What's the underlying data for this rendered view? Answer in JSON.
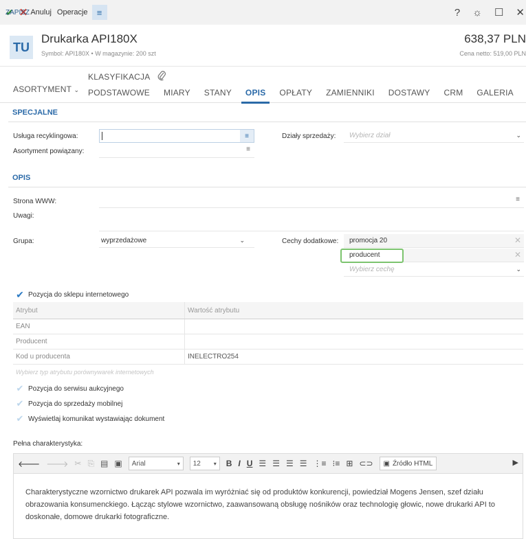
{
  "toolbar": {
    "save_label": "ZAPISZ",
    "cancel_label": "Anuluj",
    "operations_label": "Operacje",
    "menu_icon": "≡",
    "help_icon": "?",
    "settings_icon": "☼",
    "maximize_icon": "☐",
    "close_icon": "✕"
  },
  "header": {
    "badge": "TU",
    "name": "Drukarka API180X",
    "subtitle": "Symbol: API180X  •  W magazynie: 200 szt",
    "price": "638,37 PLN",
    "net_price": "Cena netto: 519,00 PLN"
  },
  "tabs": {
    "asortyment": "ASORTYMENT",
    "klasyfikacja": "KLASYFIKACJA",
    "row": [
      {
        "label": "PODSTAWOWE",
        "active": false
      },
      {
        "label": "MIARY",
        "active": false
      },
      {
        "label": "STANY",
        "active": false
      },
      {
        "label": "OPIS",
        "active": true
      },
      {
        "label": "OPŁATY",
        "active": false
      },
      {
        "label": "ZAMIENNIKI",
        "active": false
      },
      {
        "label": "DOSTAWY",
        "active": false
      },
      {
        "label": "CRM",
        "active": false
      },
      {
        "label": "GALERIA",
        "active": false
      }
    ]
  },
  "specjalne": {
    "title": "SPECJALNE",
    "recycling_label": "Usługa recyklingowa:",
    "recycling_value": "",
    "sales_dept_label": "Działy sprzedaży:",
    "sales_dept_placeholder": "Wybierz dział",
    "related_label": "Asortyment powiązany:",
    "related_value": ""
  },
  "opis": {
    "title": "OPIS",
    "www_label": "Strona WWW:",
    "www_value": "",
    "notes_label": "Uwagi:",
    "notes_value": "",
    "group_label": "Grupa:",
    "group_value": "wyprzedażowe",
    "features_label": "Cechy dodatkowe:",
    "features": [
      "promocja 20",
      "producent"
    ],
    "features_placeholder": "Wybierz cechę"
  },
  "shop": {
    "checkbox_label": "Pozycja do sklepu internetowego",
    "checked": true,
    "col_attr": "Atrybut",
    "col_value": "Wartość atrybutu",
    "rows": [
      {
        "attr": "EAN",
        "value": ""
      },
      {
        "attr": "Producent",
        "value": ""
      },
      {
        "attr": "Kod u producenta",
        "value": "INELECTRO254"
      }
    ],
    "type_placeholder": "Wybierz typ atrybutu porównywarek internetowych"
  },
  "options": [
    {
      "label": "Pozycja do serwisu aukcyjnego",
      "checked": false
    },
    {
      "label": "Pozycja do sprzedaży mobilnej",
      "checked": false
    },
    {
      "label": "Wyświetlaj komunikat wystawiając dokument",
      "checked": false
    }
  ],
  "editor": {
    "label": "Pełna charakterystyka:",
    "font": "Arial",
    "size": "12",
    "source_label": "Źródło HTML",
    "text": "Charakterystyczne wzornictwo drukarek API pozwala im wyróżniać się od produktów konkurencji, powiedział Mogens Jensen, szef działu obrazowania konsumenckiego. Łącząc stylowe wzornictwo, zaawansowaną obsługę nośników oraz technologię głowic, nowe drukarki API to doskonałe, domowe drukarki fotograficzne."
  },
  "colors": {
    "accent": "#2b6aa8",
    "save_green": "#2a8a2a",
    "cancel_red": "#d83a2a",
    "highlight_green": "#7cc46e"
  }
}
